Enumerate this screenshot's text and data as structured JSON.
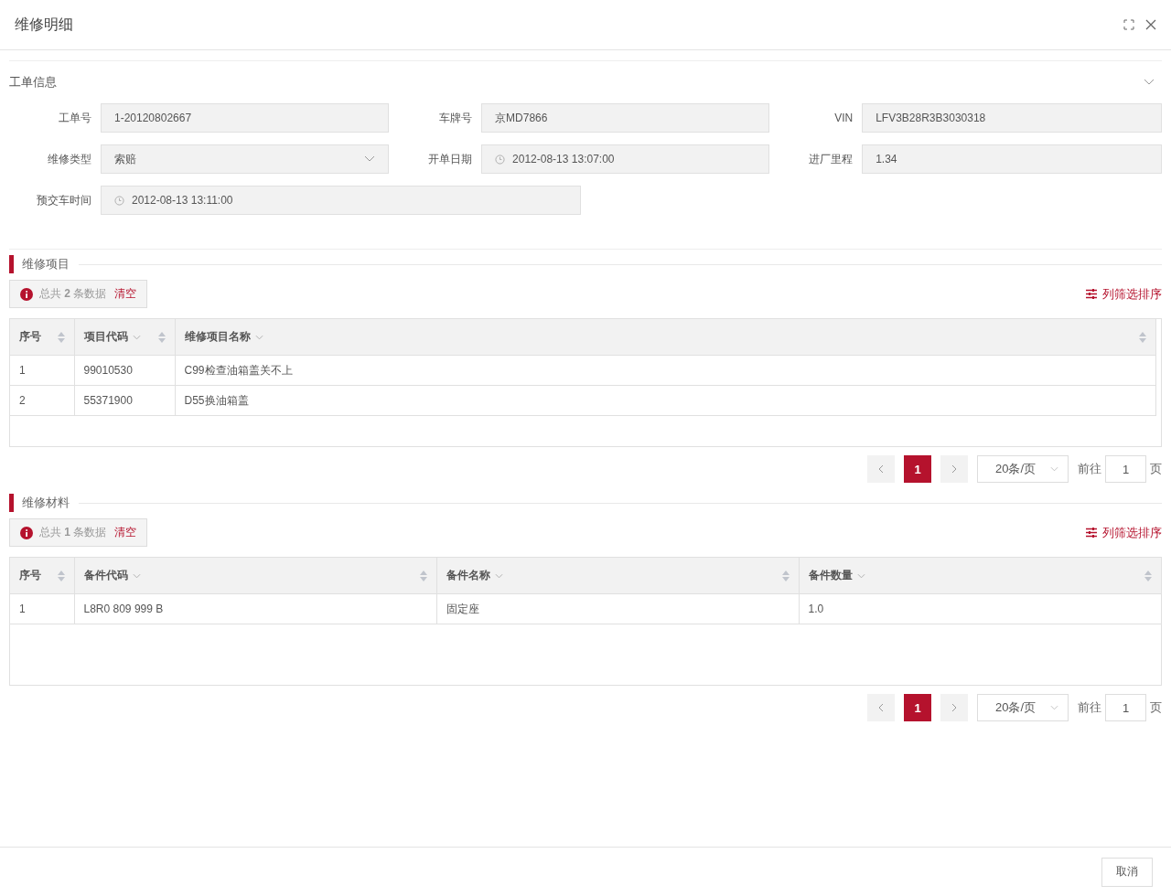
{
  "window": {
    "title": "维修明细"
  },
  "order_info": {
    "title": "工单信息",
    "expanded": true,
    "rows": [
      [
        {
          "label": "工单号",
          "kind": "text",
          "value": "1-20120802667"
        },
        {
          "label": "车牌号",
          "kind": "text",
          "value": "京MD7866"
        },
        {
          "label": "VIN",
          "kind": "text",
          "value": "LFV3B28R3B3030318"
        }
      ],
      [
        {
          "label": "维修类型",
          "kind": "select",
          "value": "索赔"
        },
        {
          "label": "开单日期",
          "kind": "date",
          "value": "2012-08-13 13:07:00"
        },
        {
          "label": "进厂里程",
          "kind": "text",
          "value": "1.34"
        }
      ],
      [
        {
          "label": "预交车时间",
          "kind": "date",
          "value": "2012-08-13 13:11:00"
        }
      ]
    ]
  },
  "sections": [
    {
      "title": "维修项目",
      "summary": "总共 **2** 条数据",
      "clear": "清空",
      "column_settings": "列筛选排序",
      "columns": [
        {
          "label": "序号",
          "sortable": true,
          "filter": false
        },
        {
          "label": "项目代码",
          "sortable": true,
          "filter": true
        },
        {
          "label": "维修项目名称",
          "sortable": true,
          "filter": true
        }
      ],
      "rows": [
        [
          "1",
          "99010530",
          "C99检查油箱盖关不上"
        ],
        [
          "2",
          "55371900",
          "D55换油箱盖"
        ]
      ],
      "pagination": {
        "pages": [
          {
            "label": "1",
            "selected": true
          }
        ],
        "page_size": "20条/页",
        "goto_label": "前往",
        "goto_value": "1",
        "page_suffix": "页"
      }
    },
    {
      "title": "维修材料",
      "summary": "总共 **1** 条数据",
      "clear": "清空",
      "column_settings": "列筛选排序",
      "columns": [
        {
          "label": "序号",
          "sortable": true,
          "filter": false
        },
        {
          "label": "备件代码",
          "sortable": true,
          "filter": true
        },
        {
          "label": "备件名称",
          "sortable": true,
          "filter": true
        },
        {
          "label": "备件数量",
          "sortable": true,
          "filter": true
        }
      ],
      "rows": [
        [
          "1",
          "L8R0 809 999 B",
          "固定座",
          "1.0"
        ]
      ],
      "pagination": {
        "pages": [
          {
            "label": "1",
            "selected": true
          }
        ],
        "page_size": "20条/页",
        "goto_label": "前往",
        "goto_value": "1",
        "page_suffix": "页"
      }
    }
  ],
  "footer": {
    "cancel": "取消"
  }
}
